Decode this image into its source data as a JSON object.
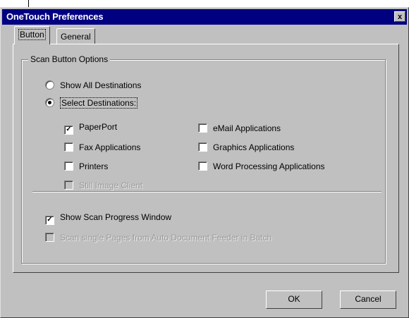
{
  "window": {
    "title": "OneTouch Preferences",
    "close_label": "x"
  },
  "tabs": [
    {
      "label": "Button",
      "selected": true
    },
    {
      "label": "General",
      "selected": false
    }
  ],
  "group": {
    "title": "Scan Button Options"
  },
  "radios": [
    {
      "label": "Show All Destinations",
      "checked": false
    },
    {
      "label": "Select Destinations:",
      "checked": true
    }
  ],
  "destinations_left": [
    {
      "label": "PaperPort",
      "checked": true,
      "mark": "✓"
    },
    {
      "label": "Fax Applications",
      "checked": false,
      "mark": ""
    },
    {
      "label": "Printers",
      "checked": false,
      "mark": ""
    },
    {
      "label": "Still Image Client",
      "checked": false,
      "disabled": true,
      "mark": ""
    }
  ],
  "destinations_right": [
    {
      "label": "eMail Applications",
      "checked": false,
      "mark": ""
    },
    {
      "label": "Graphics Applications",
      "checked": false,
      "mark": ""
    },
    {
      "label": "Word Processing Applications",
      "checked": false,
      "mark": ""
    }
  ],
  "options": [
    {
      "label": "Show Scan Progress Window",
      "checked": true,
      "mark": "✓"
    },
    {
      "label": "Scan single Pages from Auto Document Feeder in Batch",
      "checked": false,
      "disabled": true,
      "mark": ""
    }
  ],
  "buttons": {
    "ok": "OK",
    "cancel": "Cancel"
  }
}
